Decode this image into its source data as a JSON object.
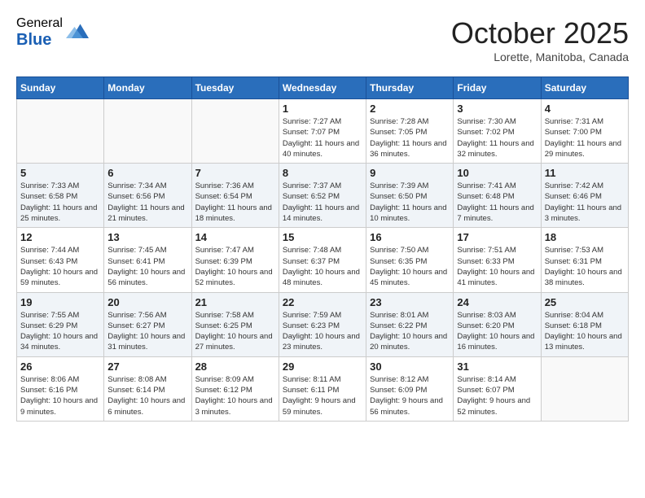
{
  "header": {
    "logo_general": "General",
    "logo_blue": "Blue",
    "month_title": "October 2025",
    "location": "Lorette, Manitoba, Canada"
  },
  "days_of_week": [
    "Sunday",
    "Monday",
    "Tuesday",
    "Wednesday",
    "Thursday",
    "Friday",
    "Saturday"
  ],
  "weeks": [
    [
      {
        "day": "",
        "sunrise": "",
        "sunset": "",
        "daylight": ""
      },
      {
        "day": "",
        "sunrise": "",
        "sunset": "",
        "daylight": ""
      },
      {
        "day": "",
        "sunrise": "",
        "sunset": "",
        "daylight": ""
      },
      {
        "day": "1",
        "sunrise": "Sunrise: 7:27 AM",
        "sunset": "Sunset: 7:07 PM",
        "daylight": "Daylight: 11 hours and 40 minutes."
      },
      {
        "day": "2",
        "sunrise": "Sunrise: 7:28 AM",
        "sunset": "Sunset: 7:05 PM",
        "daylight": "Daylight: 11 hours and 36 minutes."
      },
      {
        "day": "3",
        "sunrise": "Sunrise: 7:30 AM",
        "sunset": "Sunset: 7:02 PM",
        "daylight": "Daylight: 11 hours and 32 minutes."
      },
      {
        "day": "4",
        "sunrise": "Sunrise: 7:31 AM",
        "sunset": "Sunset: 7:00 PM",
        "daylight": "Daylight: 11 hours and 29 minutes."
      }
    ],
    [
      {
        "day": "5",
        "sunrise": "Sunrise: 7:33 AM",
        "sunset": "Sunset: 6:58 PM",
        "daylight": "Daylight: 11 hours and 25 minutes."
      },
      {
        "day": "6",
        "sunrise": "Sunrise: 7:34 AM",
        "sunset": "Sunset: 6:56 PM",
        "daylight": "Daylight: 11 hours and 21 minutes."
      },
      {
        "day": "7",
        "sunrise": "Sunrise: 7:36 AM",
        "sunset": "Sunset: 6:54 PM",
        "daylight": "Daylight: 11 hours and 18 minutes."
      },
      {
        "day": "8",
        "sunrise": "Sunrise: 7:37 AM",
        "sunset": "Sunset: 6:52 PM",
        "daylight": "Daylight: 11 hours and 14 minutes."
      },
      {
        "day": "9",
        "sunrise": "Sunrise: 7:39 AM",
        "sunset": "Sunset: 6:50 PM",
        "daylight": "Daylight: 11 hours and 10 minutes."
      },
      {
        "day": "10",
        "sunrise": "Sunrise: 7:41 AM",
        "sunset": "Sunset: 6:48 PM",
        "daylight": "Daylight: 11 hours and 7 minutes."
      },
      {
        "day": "11",
        "sunrise": "Sunrise: 7:42 AM",
        "sunset": "Sunset: 6:46 PM",
        "daylight": "Daylight: 11 hours and 3 minutes."
      }
    ],
    [
      {
        "day": "12",
        "sunrise": "Sunrise: 7:44 AM",
        "sunset": "Sunset: 6:43 PM",
        "daylight": "Daylight: 10 hours and 59 minutes."
      },
      {
        "day": "13",
        "sunrise": "Sunrise: 7:45 AM",
        "sunset": "Sunset: 6:41 PM",
        "daylight": "Daylight: 10 hours and 56 minutes."
      },
      {
        "day": "14",
        "sunrise": "Sunrise: 7:47 AM",
        "sunset": "Sunset: 6:39 PM",
        "daylight": "Daylight: 10 hours and 52 minutes."
      },
      {
        "day": "15",
        "sunrise": "Sunrise: 7:48 AM",
        "sunset": "Sunset: 6:37 PM",
        "daylight": "Daylight: 10 hours and 48 minutes."
      },
      {
        "day": "16",
        "sunrise": "Sunrise: 7:50 AM",
        "sunset": "Sunset: 6:35 PM",
        "daylight": "Daylight: 10 hours and 45 minutes."
      },
      {
        "day": "17",
        "sunrise": "Sunrise: 7:51 AM",
        "sunset": "Sunset: 6:33 PM",
        "daylight": "Daylight: 10 hours and 41 minutes."
      },
      {
        "day": "18",
        "sunrise": "Sunrise: 7:53 AM",
        "sunset": "Sunset: 6:31 PM",
        "daylight": "Daylight: 10 hours and 38 minutes."
      }
    ],
    [
      {
        "day": "19",
        "sunrise": "Sunrise: 7:55 AM",
        "sunset": "Sunset: 6:29 PM",
        "daylight": "Daylight: 10 hours and 34 minutes."
      },
      {
        "day": "20",
        "sunrise": "Sunrise: 7:56 AM",
        "sunset": "Sunset: 6:27 PM",
        "daylight": "Daylight: 10 hours and 31 minutes."
      },
      {
        "day": "21",
        "sunrise": "Sunrise: 7:58 AM",
        "sunset": "Sunset: 6:25 PM",
        "daylight": "Daylight: 10 hours and 27 minutes."
      },
      {
        "day": "22",
        "sunrise": "Sunrise: 7:59 AM",
        "sunset": "Sunset: 6:23 PM",
        "daylight": "Daylight: 10 hours and 23 minutes."
      },
      {
        "day": "23",
        "sunrise": "Sunrise: 8:01 AM",
        "sunset": "Sunset: 6:22 PM",
        "daylight": "Daylight: 10 hours and 20 minutes."
      },
      {
        "day": "24",
        "sunrise": "Sunrise: 8:03 AM",
        "sunset": "Sunset: 6:20 PM",
        "daylight": "Daylight: 10 hours and 16 minutes."
      },
      {
        "day": "25",
        "sunrise": "Sunrise: 8:04 AM",
        "sunset": "Sunset: 6:18 PM",
        "daylight": "Daylight: 10 hours and 13 minutes."
      }
    ],
    [
      {
        "day": "26",
        "sunrise": "Sunrise: 8:06 AM",
        "sunset": "Sunset: 6:16 PM",
        "daylight": "Daylight: 10 hours and 9 minutes."
      },
      {
        "day": "27",
        "sunrise": "Sunrise: 8:08 AM",
        "sunset": "Sunset: 6:14 PM",
        "daylight": "Daylight: 10 hours and 6 minutes."
      },
      {
        "day": "28",
        "sunrise": "Sunrise: 8:09 AM",
        "sunset": "Sunset: 6:12 PM",
        "daylight": "Daylight: 10 hours and 3 minutes."
      },
      {
        "day": "29",
        "sunrise": "Sunrise: 8:11 AM",
        "sunset": "Sunset: 6:11 PM",
        "daylight": "Daylight: 9 hours and 59 minutes."
      },
      {
        "day": "30",
        "sunrise": "Sunrise: 8:12 AM",
        "sunset": "Sunset: 6:09 PM",
        "daylight": "Daylight: 9 hours and 56 minutes."
      },
      {
        "day": "31",
        "sunrise": "Sunrise: 8:14 AM",
        "sunset": "Sunset: 6:07 PM",
        "daylight": "Daylight: 9 hours and 52 minutes."
      },
      {
        "day": "",
        "sunrise": "",
        "sunset": "",
        "daylight": ""
      }
    ]
  ]
}
